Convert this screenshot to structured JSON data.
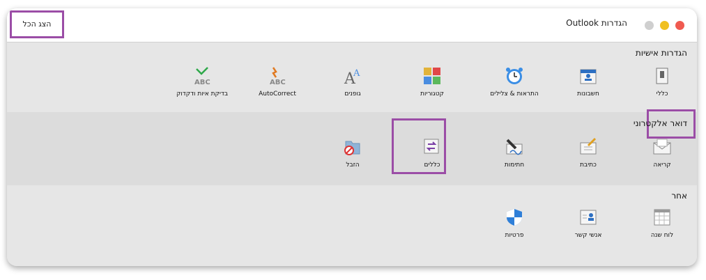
{
  "window": {
    "title": "הגדרות Outlook",
    "show_all_label": "הצג הכל"
  },
  "sections": {
    "personal": {
      "title": "הגדרות אישיות",
      "items": [
        {
          "label": "כללי",
          "icon": "switch-icon"
        },
        {
          "label": "חשבונות",
          "icon": "accounts-icon"
        },
        {
          "label": "התראות & צלילים",
          "icon": "alarm-clock-icon"
        },
        {
          "label": "קטגוריות",
          "icon": "categories-icon"
        },
        {
          "label": "גופנים",
          "icon": "fonts-icon"
        },
        {
          "label": "AutoCorrect",
          "icon": "autocorrect-icon"
        },
        {
          "label": "בדיקת איות ודקדוק",
          "icon": "spelling-icon"
        }
      ]
    },
    "email": {
      "title": "דואר אלקטרוני",
      "items": [
        {
          "label": "קריאה",
          "icon": "envelope-icon"
        },
        {
          "label": "כתיבת",
          "icon": "compose-icon"
        },
        {
          "label": "חתימות",
          "icon": "signature-icon"
        },
        {
          "label": "כללים",
          "icon": "rules-icon"
        },
        {
          "label": "הזבל",
          "icon": "junk-folder-icon"
        }
      ]
    },
    "other": {
      "title": "אחר",
      "items": [
        {
          "label": "לוח שנה",
          "icon": "calendar-icon"
        },
        {
          "label": "אנשי קשר",
          "icon": "contacts-icon"
        },
        {
          "label": "פרטיות",
          "icon": "shield-icon"
        }
      ]
    }
  },
  "colors": {
    "highlight": "#9b4da6",
    "close": "#f05a50",
    "minimize": "#f0c020",
    "zoom": "#cfcfcf"
  }
}
